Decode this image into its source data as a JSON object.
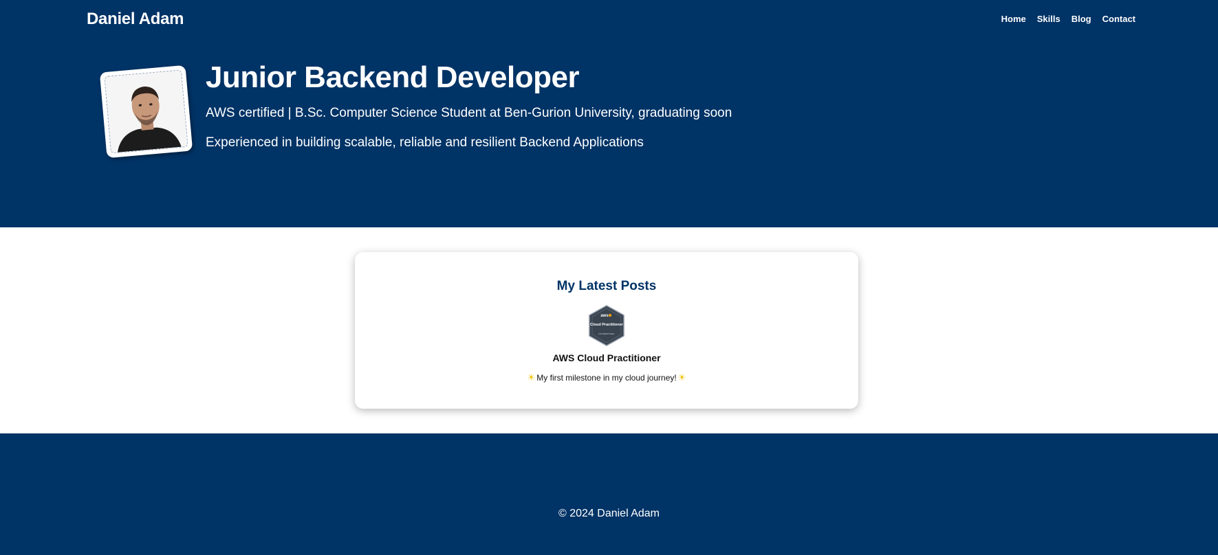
{
  "header": {
    "brand": "Daniel Adam",
    "nav": [
      {
        "label": "Home"
      },
      {
        "label": "Skills"
      },
      {
        "label": "Blog"
      },
      {
        "label": "Contact"
      }
    ]
  },
  "hero": {
    "title": "Junior Backend Developer",
    "subtitle": "AWS certified | B.Sc. Computer Science Student at Ben-Gurion University, graduating soon",
    "description": "Experienced in building scalable, reliable and resilient Backend Applications",
    "avatar_icon": "profile-photo"
  },
  "posts": {
    "heading": "My Latest Posts",
    "items": [
      {
        "badge_icon": "aws-cloud-practitioner-badge",
        "badge_text_top": "aws",
        "badge_text_main": "Cloud Practitioner",
        "badge_text_bottom": "FOUNDATIONAL",
        "title": "AWS Cloud Practitioner",
        "description": "My first milestone in my cloud journey!",
        "sparkle": "☀"
      }
    ]
  },
  "footer": {
    "copyright": "© 2024 Daniel Adam"
  },
  "colors": {
    "primary": "#003366",
    "text_light": "#ffffff",
    "card_bg": "#ffffff"
  }
}
